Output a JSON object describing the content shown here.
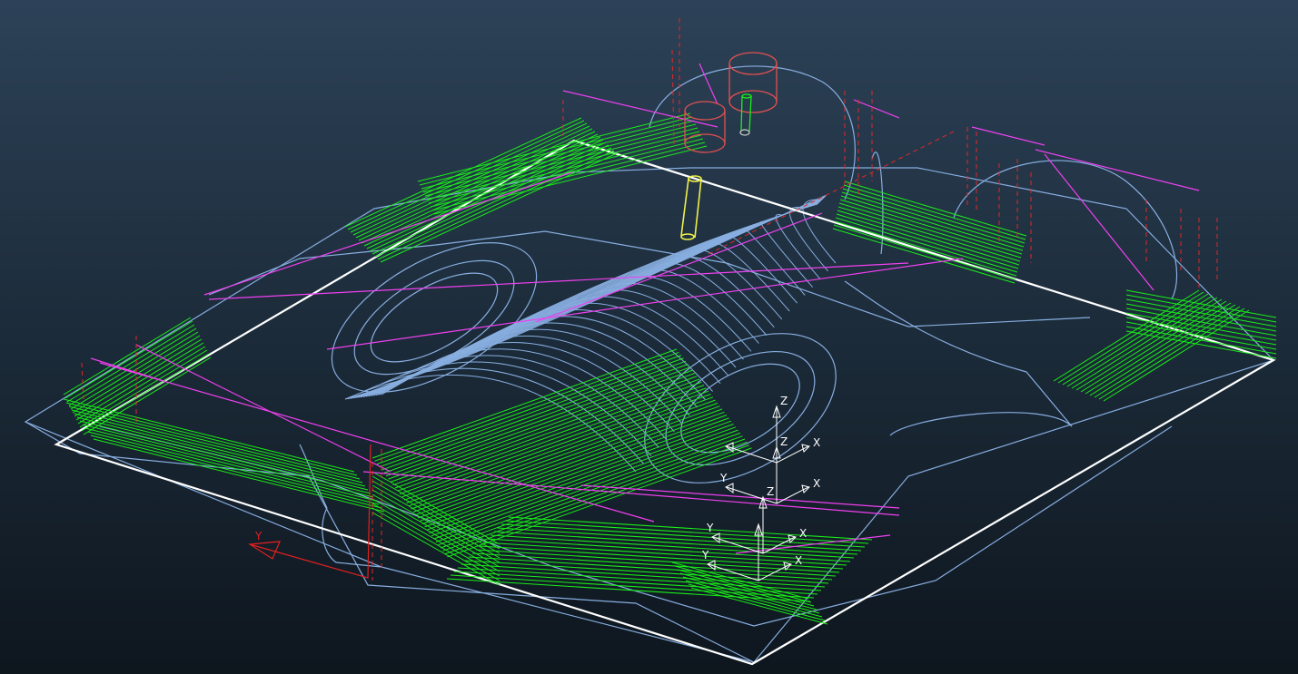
{
  "colors": {
    "background_top": "#2d4258",
    "background_bottom": "#0e161e",
    "model_wireframe": "#88aee0",
    "toolpath": "#18f018",
    "leads_links": "#f040f0",
    "rapid_moves": "#e02828",
    "stock_box": "#ffffff",
    "tool": "#f0f048",
    "tool_holder": "#e05050",
    "workplane": "#ffffff",
    "global_axis": "#e02020"
  },
  "icons": {
    "tool": "cylindrical-cutter-icon",
    "workplane": "axis-triad-icon"
  },
  "axes": {
    "x": "X",
    "y": "Y",
    "z": "Z"
  },
  "workplanes": [
    {
      "x": "X",
      "y": "Y",
      "z": "Z"
    },
    {
      "x": "X",
      "y": "",
      "z": "Z"
    },
    {
      "x": "X",
      "y": "Y",
      "z": "Z"
    },
    {
      "x": "X",
      "y": "Y",
      "z": ""
    }
  ],
  "global_axis": {
    "y": "Y"
  }
}
